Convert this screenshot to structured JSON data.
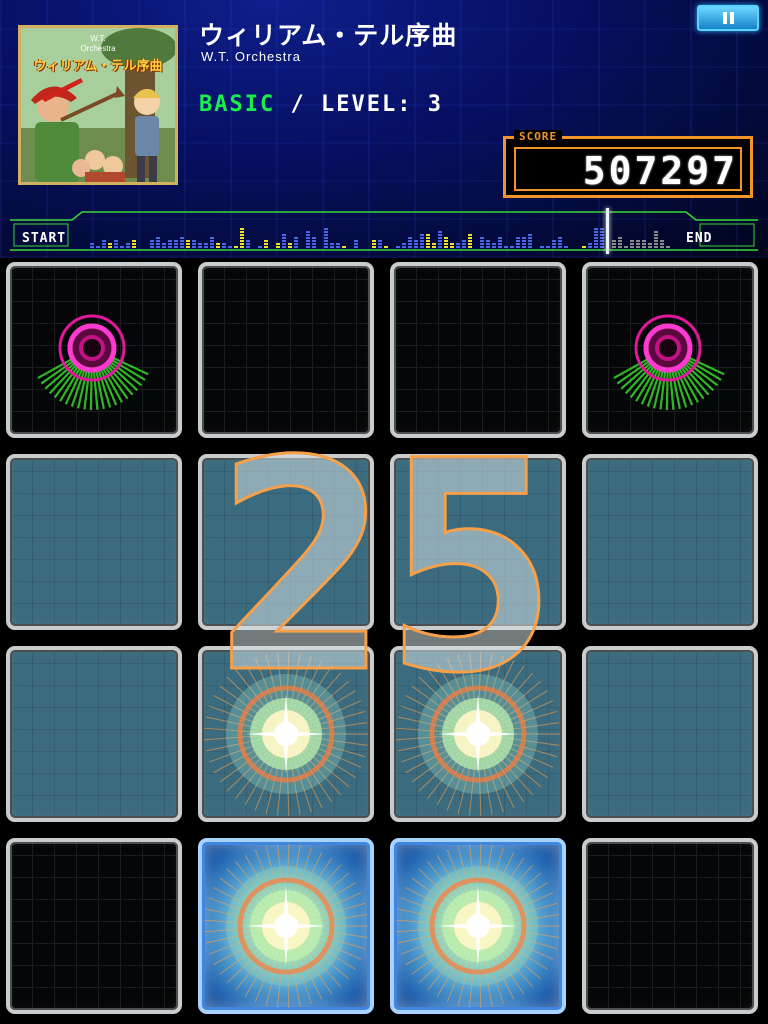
{
  "song": {
    "title": "ウィリアム・テル序曲",
    "artist": "W.T. Orchestra",
    "jacket": {
      "top_line1": "W.T.",
      "top_line2": "Orchestra",
      "title": "ウィリアム・テル序曲"
    }
  },
  "chart_info": {
    "difficulty": "BASIC",
    "separator": "/",
    "level_label": "LEVEL:",
    "level_value": "3"
  },
  "score": {
    "label": "SCORE",
    "value": "507297"
  },
  "progress": {
    "start_label": "START",
    "end_label": "END",
    "position_fraction": 0.87
  },
  "pause": {
    "icon": "pause-icon"
  },
  "combo": {
    "count": "25"
  },
  "colors": {
    "difficulty": "#18f04a",
    "score_border": "#f2942a",
    "marker_ring": "#e0189a",
    "marker_fan": "#39d62b",
    "panel_lit": "#3b6b7e",
    "panel_pressed": "#1d5fae"
  },
  "grid": {
    "rows": 4,
    "cols": 4,
    "panels": [
      [
        "marker",
        "empty",
        "empty",
        "marker"
      ],
      [
        "lit",
        "lit",
        "lit",
        "lit"
      ],
      [
        "lit",
        "burst",
        "burst",
        "lit"
      ],
      [
        "empty",
        "pressed",
        "pressed",
        "empty"
      ]
    ]
  }
}
